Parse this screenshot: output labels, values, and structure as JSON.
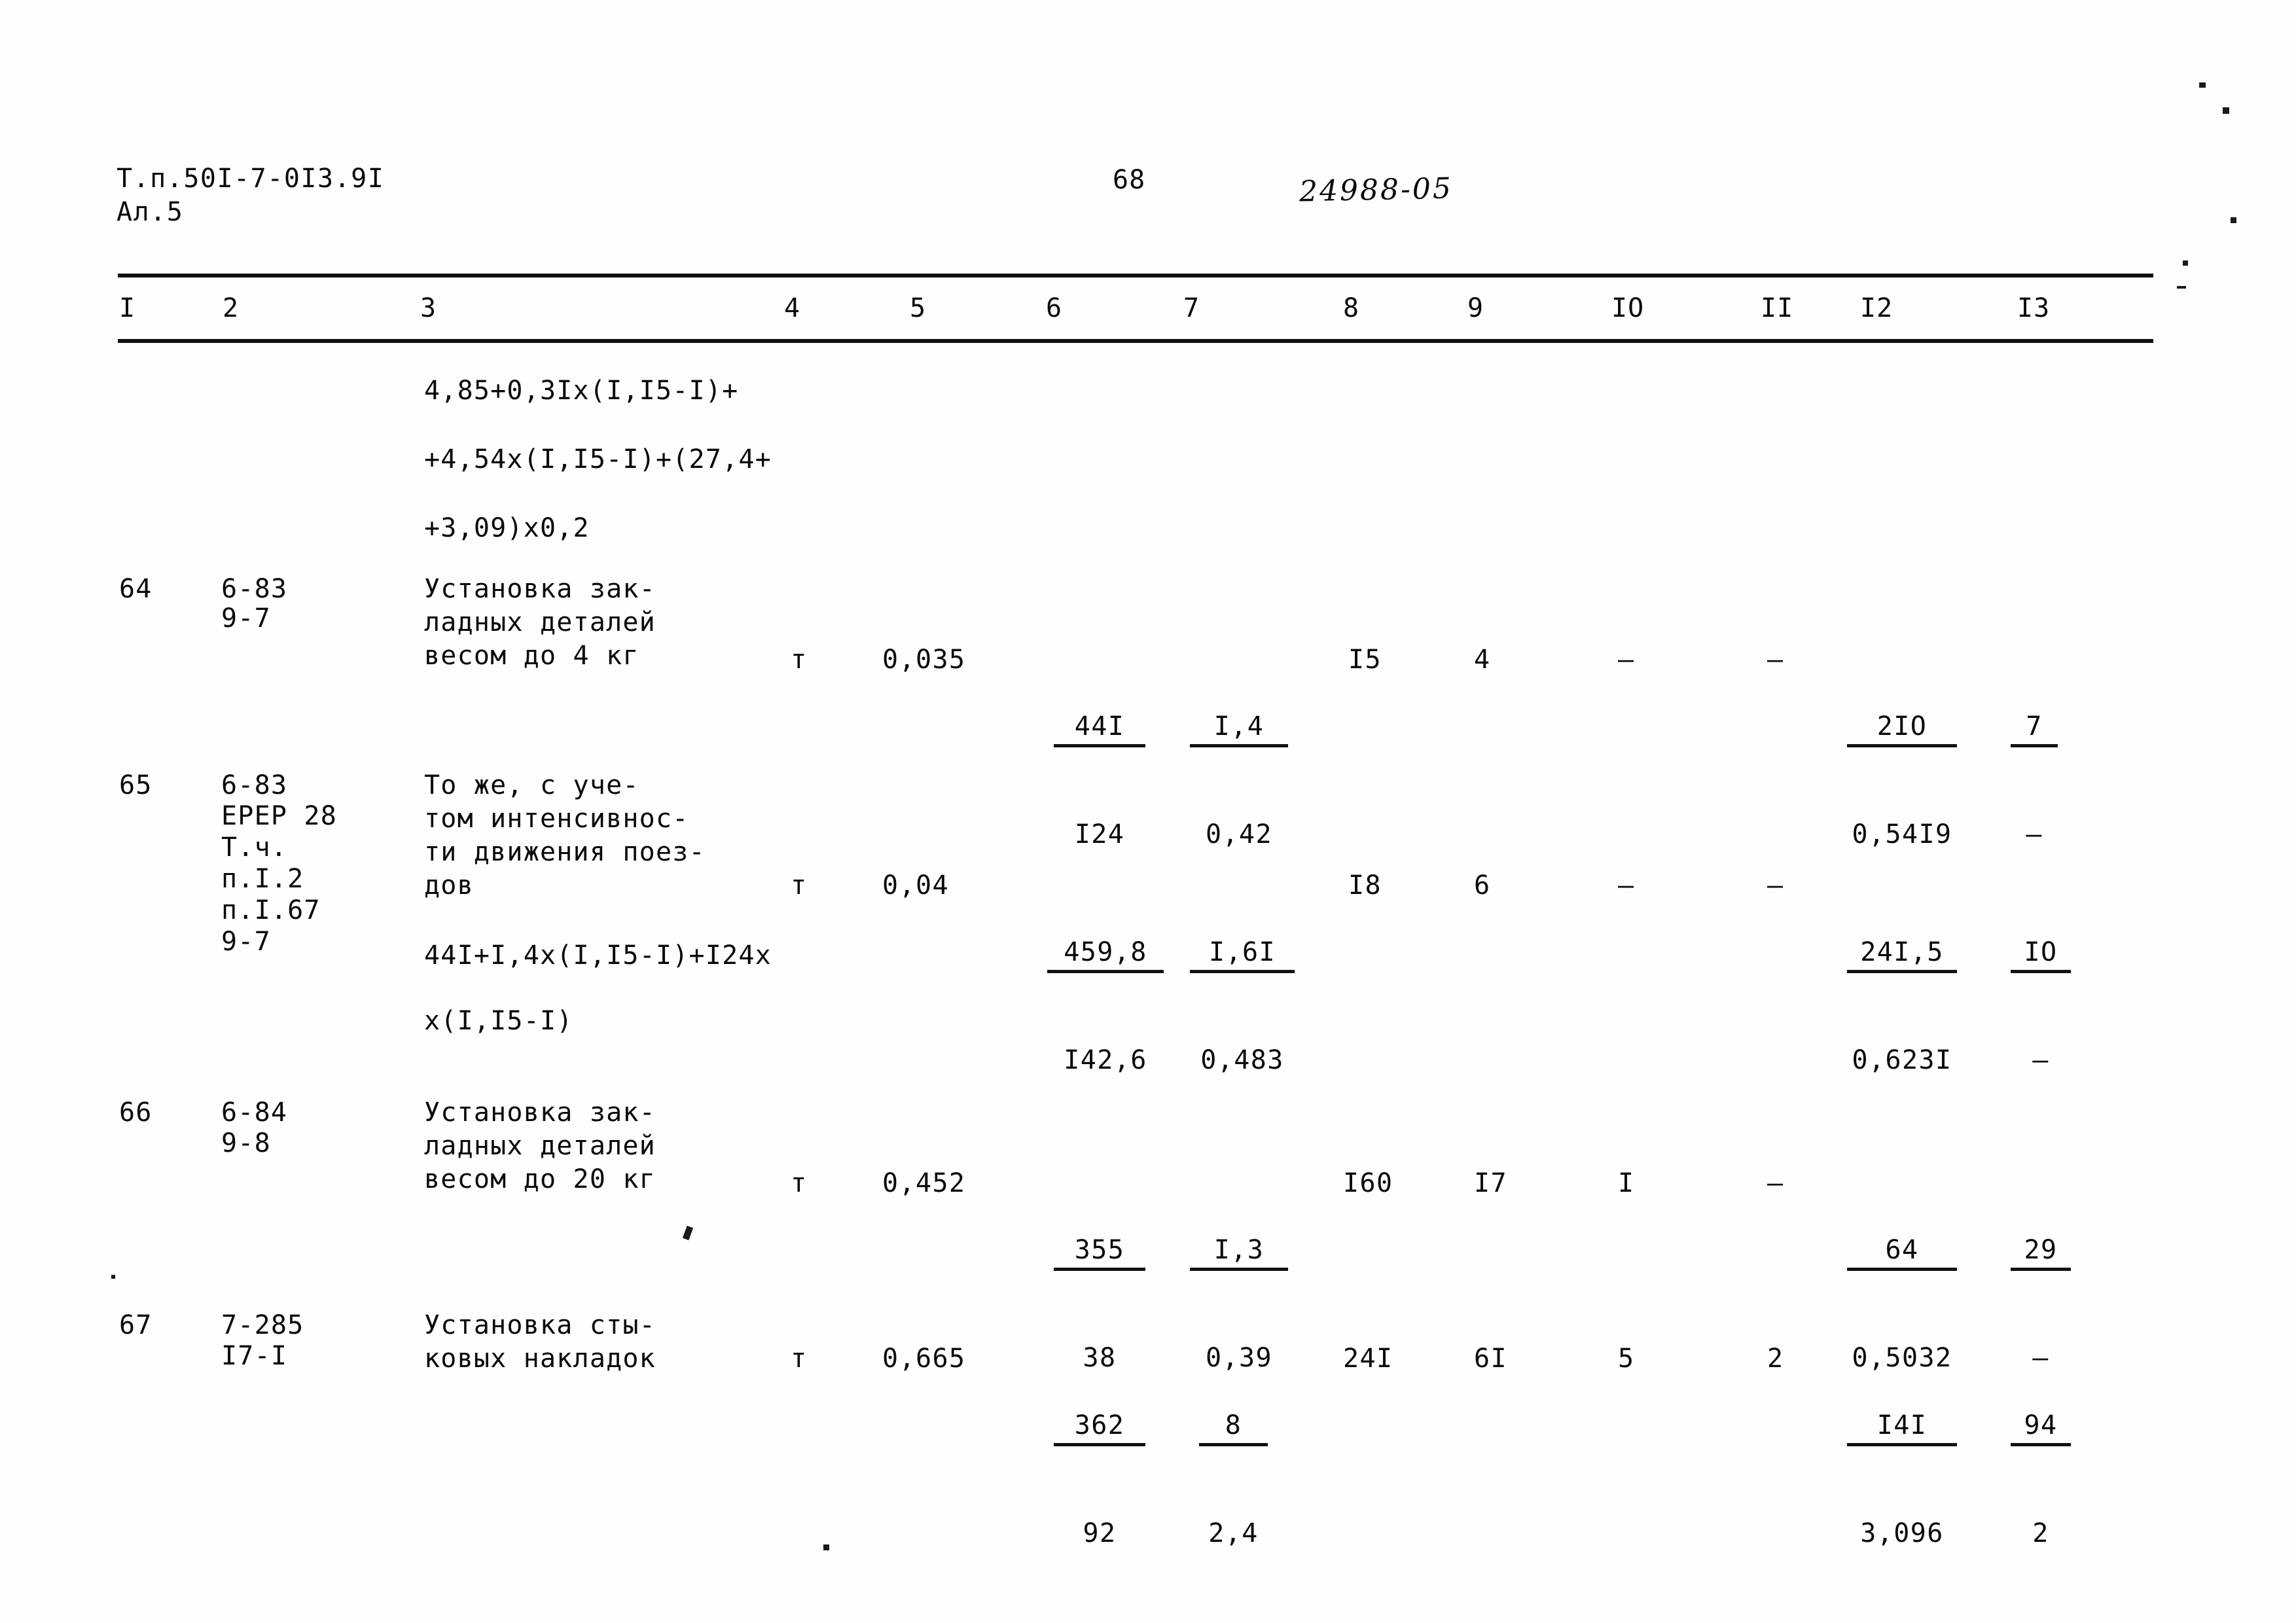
{
  "header": {
    "doc_code_line1": "Т.п.50I-7-0I3.9I",
    "doc_code_line2": "Ал.5",
    "page_number": "68",
    "archive_mark": "24988-05"
  },
  "table": {
    "column_headers": [
      "I",
      "2",
      "3",
      "4",
      "5",
      "6",
      "7",
      "8",
      "9",
      "IO",
      "II",
      "I2",
      "I3"
    ],
    "continued_formula": [
      "4,85+0,3Iх(I,I5-I)+",
      "+4,54х(I,I5-I)+(27,4+",
      "+3,09)х0,2"
    ],
    "rows": [
      {
        "no": "64",
        "code_lines": [
          "6-83",
          "9-7"
        ],
        "description_lines": [
          "Установка зак-",
          "ладных деталей",
          "весом до 4 кг"
        ],
        "unit": "т",
        "c5": "0,035",
        "c6_top": "44I",
        "c6_bot": "I24",
        "c7_top": "I,4",
        "c7_bot": "0,42",
        "c8": "I5",
        "c9": "4",
        "c10": "—",
        "c11": "—",
        "c12_top": "2IO",
        "c12_bot": "0,54I9",
        "c13_top": "7",
        "c13_bot": "—"
      },
      {
        "no": "65",
        "code_lines": [
          "6-83",
          "ЕРЕР 28",
          "Т.ч.",
          "п.I.2",
          "п.I.67",
          "9-7"
        ],
        "description_lines": [
          "То же, с уче-",
          "том интенсивнос-",
          "ти движения поез-",
          "дов"
        ],
        "formula_lines": [
          "44I+I,4х(I,I5-I)+I24х",
          "х(I,I5-I)"
        ],
        "unit": "т",
        "c5": "0,04",
        "c6_top": "459,8",
        "c6_bot": "I42,6",
        "c7_top": "I,6I",
        "c7_bot": "0,483",
        "c8": "I8",
        "c9": "6",
        "c10": "—",
        "c11": "—",
        "c12_top": "24I,5",
        "c12_bot": "0,623I",
        "c13_top": "IO",
        "c13_bot": "—"
      },
      {
        "no": "66",
        "code_lines": [
          "6-84",
          "9-8"
        ],
        "description_lines": [
          "Установка зак-",
          "ладных деталей",
          "весом до 20 кг"
        ],
        "unit": "т",
        "c5": "0,452",
        "c6_top": "355",
        "c6_bot": "38",
        "c7_top": "I,3",
        "c7_bot": "0,39",
        "c8": "I60",
        "c9": "I7",
        "c10": "I",
        "c11": "—",
        "c12_top": "64",
        "c12_bot": "0,5032",
        "c13_top": "29",
        "c13_bot": "—"
      },
      {
        "no": "67",
        "code_lines": [
          "7-285",
          "I7-I"
        ],
        "description_lines": [
          "Установка сты-",
          "ковых накладок"
        ],
        "unit": "т",
        "c5": "0,665",
        "c6_top": "362",
        "c6_bot": "92",
        "c7_top": "8",
        "c7_bot": "2,4",
        "c8": "24I",
        "c9": "6I",
        "c10": "5",
        "c11": "2",
        "c12_top": "I4I",
        "c12_bot": "3,096",
        "c13_top": "94",
        "c13_bot": "2"
      }
    ]
  }
}
